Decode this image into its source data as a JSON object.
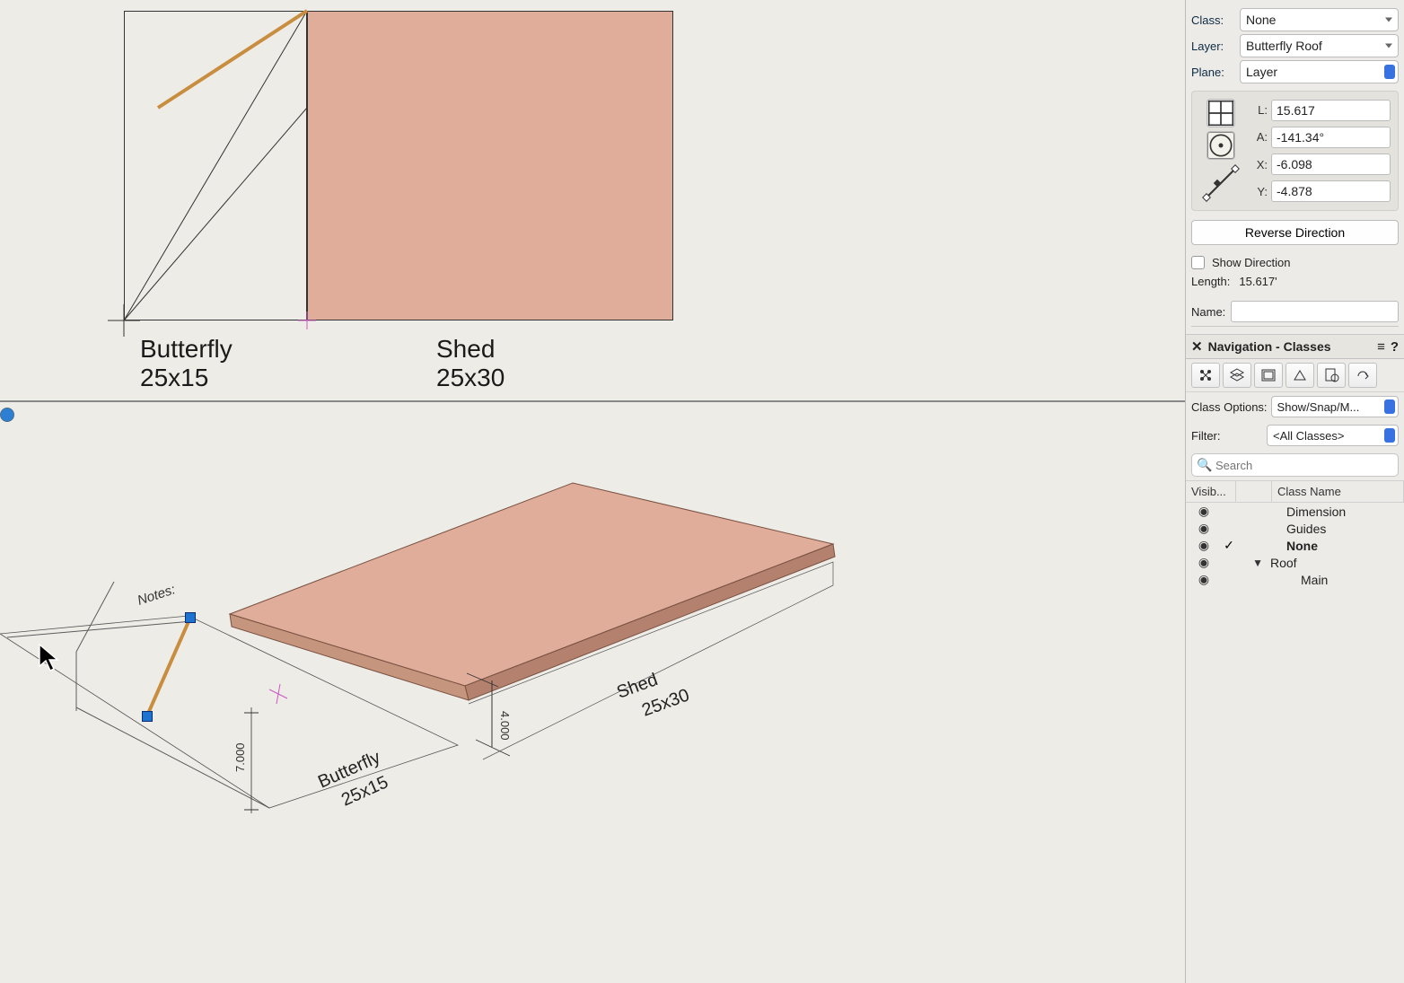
{
  "props": {
    "class_label": "Class:",
    "class_value": "None",
    "layer_label": "Layer:",
    "layer_value": "Butterfly Roof",
    "plane_label": "Plane:",
    "plane_value": "Layer",
    "L_label": "L:",
    "L_value": "15.617",
    "A_label": "A:",
    "A_value": "-141.34°",
    "X_label": "X:",
    "X_value": "-6.098",
    "Y_label": "Y:",
    "Y_value": "-4.878",
    "reverse_btn": "Reverse Direction",
    "show_dir": "Show Direction",
    "length_label": "Length:",
    "length_value": "15.617'",
    "name_label": "Name:",
    "name_value": ""
  },
  "nav": {
    "title": "Navigation - Classes",
    "class_options_label": "Class Options:",
    "class_options_value": "Show/Snap/M...",
    "filter_label": "Filter:",
    "filter_value": "<All Classes>",
    "search_placeholder": "Search",
    "col_visib": "Visib...",
    "col_classname": "Class Name",
    "items": [
      {
        "name": "Dimension",
        "eye": true,
        "check": false,
        "disclosure": "",
        "indent": "indent"
      },
      {
        "name": "Guides",
        "eye": true,
        "check": false,
        "disclosure": "",
        "indent": "indent"
      },
      {
        "name": "None",
        "eye": true,
        "check": true,
        "disclosure": "",
        "indent": "indent",
        "bold": true
      },
      {
        "name": "Roof",
        "eye": true,
        "check": false,
        "disclosure": "▼",
        "indent": ""
      },
      {
        "name": "Main",
        "eye": true,
        "check": false,
        "disclosure": "",
        "indent": "indent2"
      }
    ]
  },
  "drawing": {
    "butterfly_label1": "Butterfly",
    "butterfly_label2": "25x15",
    "shed_label1": "Shed",
    "shed_label2": "25x30",
    "notes": "Notes:",
    "dim_height": "4.000",
    "dim_height2": "7.000",
    "shed_3d_1": "Shed",
    "shed_3d_2": "25x30",
    "butterfly_3d_1": "Butterfly",
    "butterfly_3d_2": "25x15"
  }
}
